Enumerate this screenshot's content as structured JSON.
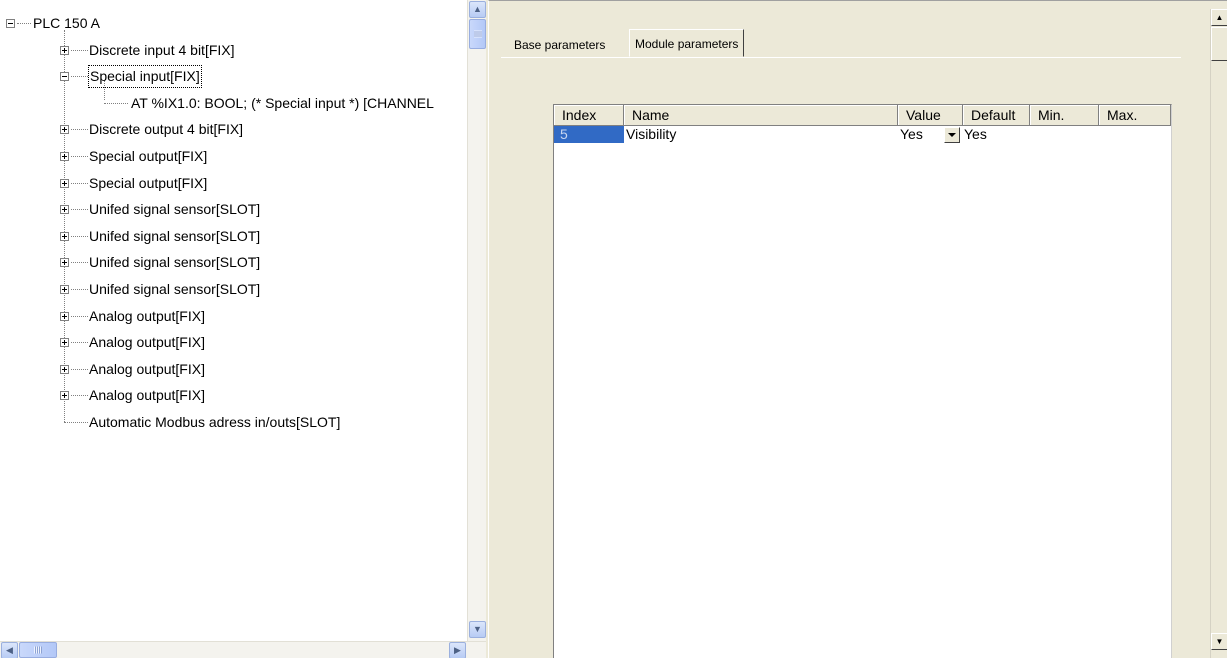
{
  "tree": {
    "root": {
      "label": "PLC 150 A",
      "state": "expanded"
    },
    "items": [
      {
        "label": "Discrete input 4 bit[FIX]",
        "state": "collapsed"
      },
      {
        "label": "Special input[FIX]",
        "state": "expanded",
        "selected": true,
        "children": [
          {
            "label": "AT %IX1.0: BOOL; (* Special input *) [CHANNEL"
          }
        ]
      },
      {
        "label": "Discrete output 4 bit[FIX]",
        "state": "collapsed"
      },
      {
        "label": "Special output[FIX]",
        "state": "collapsed"
      },
      {
        "label": "Special output[FIX]",
        "state": "collapsed"
      },
      {
        "label": "Unifed signal sensor[SLOT]",
        "state": "collapsed"
      },
      {
        "label": "Unifed signal sensor[SLOT]",
        "state": "collapsed"
      },
      {
        "label": "Unifed signal sensor[SLOT]",
        "state": "collapsed"
      },
      {
        "label": "Unifed signal sensor[SLOT]",
        "state": "collapsed"
      },
      {
        "label": "Analog output[FIX]",
        "state": "collapsed"
      },
      {
        "label": "Analog output[FIX]",
        "state": "collapsed"
      },
      {
        "label": "Analog output[FIX]",
        "state": "collapsed"
      },
      {
        "label": "Analog output[FIX]",
        "state": "collapsed"
      },
      {
        "label": "Automatic Modbus adress in/outs[SLOT]",
        "state": "leaf"
      }
    ]
  },
  "tabs": [
    {
      "label": "Base parameters",
      "active": false
    },
    {
      "label": "Module parameters",
      "active": true
    }
  ],
  "grid": {
    "columns": [
      "Index",
      "Name",
      "Value",
      "Default",
      "Min.",
      "Max."
    ],
    "rows": [
      {
        "index": "5",
        "name": "Visibility",
        "value": "Yes",
        "default": "Yes",
        "min": "",
        "max": ""
      }
    ]
  },
  "icons": {
    "scroll_up": "arrow-up-icon",
    "scroll_down": "arrow-down-icon",
    "scroll_left": "arrow-left-icon",
    "scroll_right": "arrow-right-icon",
    "tree_toggle_plus": "plus-box-icon",
    "tree_toggle_minus": "minus-box-icon",
    "dropdown": "chevron-down-icon"
  },
  "colors": {
    "selection": "#316ac5",
    "panel": "#ece9d8"
  }
}
